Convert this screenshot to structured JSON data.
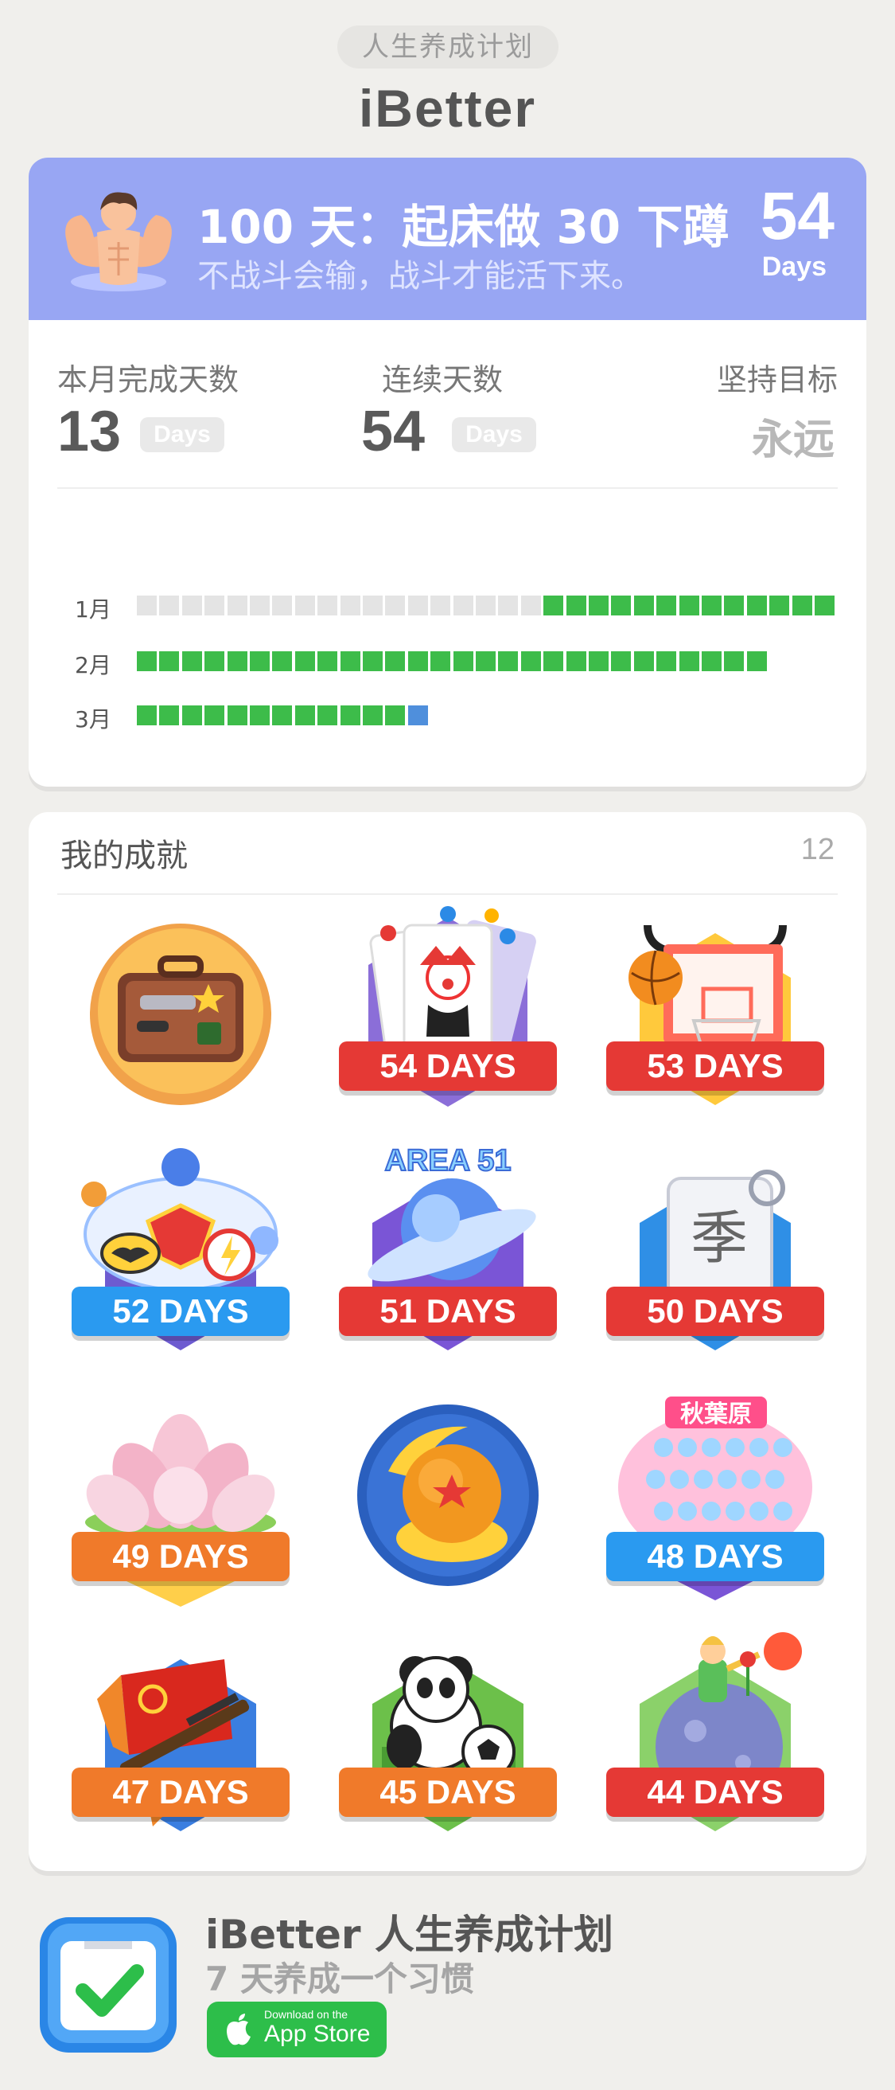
{
  "header": {
    "tagline": "人生养成计划",
    "app_name": "iBetter"
  },
  "habit": {
    "title": "100 天：起床做 30 下蹲",
    "motto": "不战斗会输，战斗才能活下来。",
    "streak_value": "54",
    "streak_unit": "Days"
  },
  "stats": {
    "month_done_label": "本月完成天数",
    "month_done_value": "13",
    "consecutive_label": "连续天数",
    "consecutive_value": "54",
    "goal_label": "坚持目标",
    "goal_value": "永远",
    "days_unit": "Days"
  },
  "calendar": {
    "colors": {
      "done": "#3dbc4a",
      "empty": "#e4e4e4",
      "today": "#4f8fdc"
    },
    "months": [
      {
        "label": "1月",
        "total": 31,
        "done_from": 19,
        "done_to": 31,
        "today": null
      },
      {
        "label": "2月",
        "total": 28,
        "done_from": 1,
        "done_to": 28,
        "today": null
      },
      {
        "label": "3月",
        "total": 13,
        "done_from": 1,
        "done_to": 12,
        "today": 13
      }
    ]
  },
  "achievements": {
    "title": "我的成就",
    "count": "12",
    "badges": [
      {
        "name": "suitcase",
        "days": null
      },
      {
        "name": "joker-cards",
        "days": "54 DAYS"
      },
      {
        "name": "basketball-hoop",
        "days": "53 DAYS"
      },
      {
        "name": "superheroes",
        "days": "52 DAYS"
      },
      {
        "name": "ufo",
        "days": "51 DAYS",
        "top_text": "AREA 51"
      },
      {
        "name": "paper-scroll",
        "days": "50 DAYS"
      },
      {
        "name": "lotus",
        "days": "49 DAYS"
      },
      {
        "name": "dragon-ball",
        "days": null
      },
      {
        "name": "idol-group",
        "days": "48 DAYS",
        "top_text": "秋葉原"
      },
      {
        "name": "flag-rifle",
        "days": "47 DAYS"
      },
      {
        "name": "panda-football",
        "days": "45 DAYS"
      },
      {
        "name": "little-prince",
        "days": "44 DAYS"
      }
    ]
  },
  "promo": {
    "title": "iBetter 人生养成计划",
    "subtitle": "7 天养成一个习惯",
    "store_small": "Download on the",
    "store_big": "App Store"
  }
}
